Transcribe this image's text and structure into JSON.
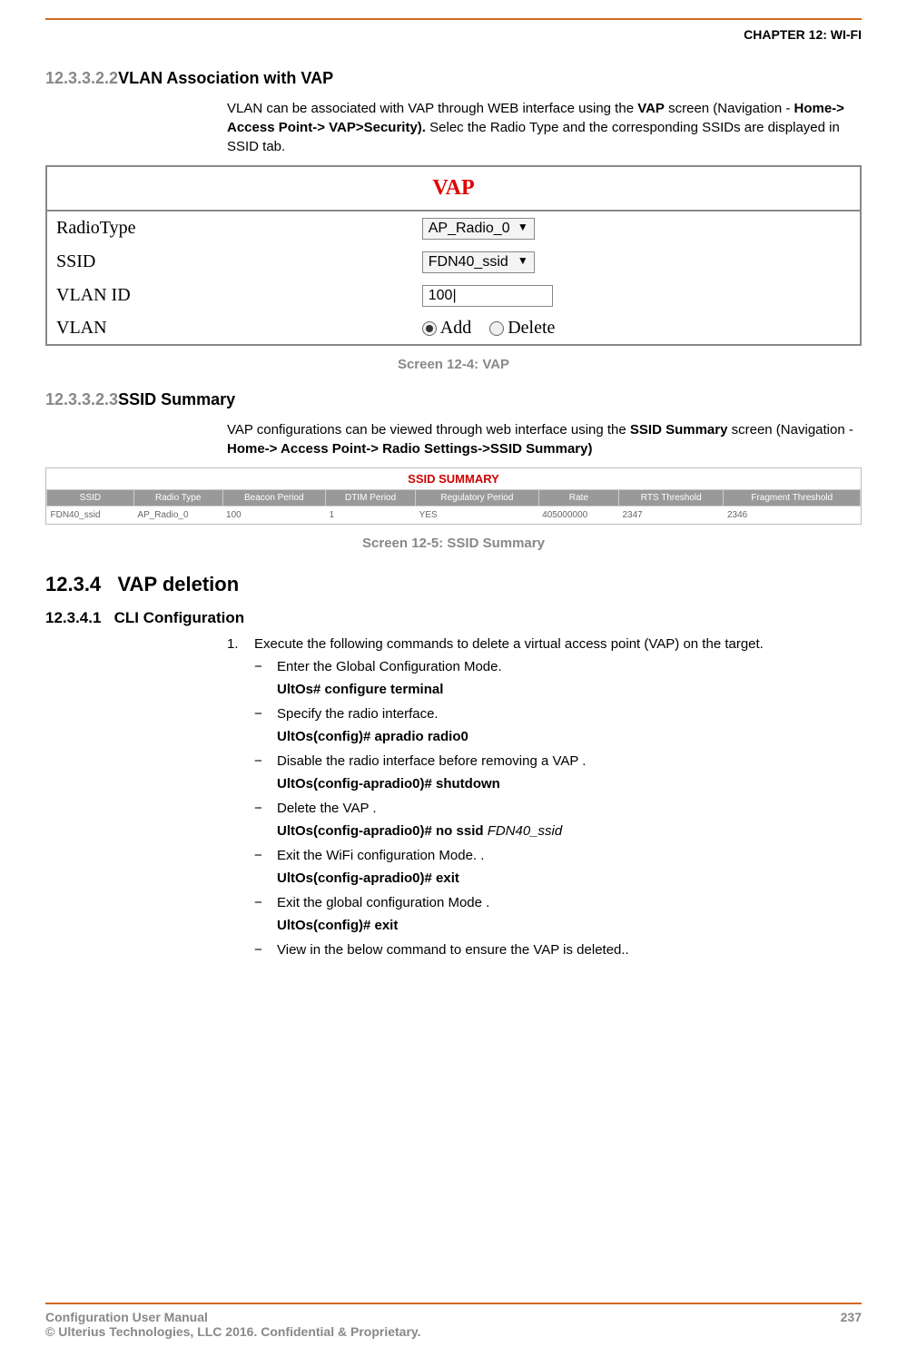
{
  "header": {
    "chapter": "CHAPTER 12: WI-FI"
  },
  "s1": {
    "num": "12.3.3.2.2",
    "title": "VLAN Association with VAP",
    "para_1": "VLAN can be associated with VAP through WEB interface using the ",
    "para_1b": "VAP",
    "para_2a": " screen (Navigation - ",
    "para_2b": "Home-> Access Point-> VAP>Security).",
    "para_2c": " Selec the Radio Type and the corresponding SSIDs are displayed in SSID tab.",
    "caption": "Screen 12-4: VAP"
  },
  "vap": {
    "title": "VAP",
    "rows": {
      "radiotype_label": "RadioType",
      "radiotype_value": "AP_Radio_0",
      "ssid_label": "SSID",
      "ssid_value": "FDN40_ssid",
      "vlanid_label": "VLAN ID",
      "vlanid_value": "100",
      "vlan_label": "VLAN",
      "add": "Add",
      "delete": "Delete"
    }
  },
  "s2": {
    "num": "12.3.3.2.3",
    "title": "SSID Summary",
    "para_a": "VAP configurations can be viewed through web interface using the ",
    "para_b": "SSID Summary",
    "para_c": " screen (Navigation - ",
    "para_d": "Home-> Access Point-> Radio Settings->SSID Summary)",
    "caption": "Screen 12-5: SSID Summary"
  },
  "ssid": {
    "title": "SSID SUMMARY",
    "headers": [
      "SSID",
      "Radio Type",
      "Beacon Period",
      "DTIM Period",
      "Regulatory Period",
      "Rate",
      "RTS Threshold",
      "Fragment Threshold"
    ],
    "row": [
      "FDN40_ssid",
      "AP_Radio_0",
      "100",
      "1",
      "YES",
      "405000000",
      "2347",
      "2346"
    ]
  },
  "s3": {
    "num": "12.3.4",
    "title": "VAP deletion"
  },
  "s4": {
    "num": "12.3.4.1",
    "title": "CLI Configuration",
    "step1": "Execute the following commands to delete a virtual access point (VAP) on the target.",
    "d1": "Enter the Global Configuration Mode.",
    "c1": "UltOs# configure terminal",
    "d2": "Specify the radio interface.",
    "c2": " UltOs(config)# apradio radio0",
    "d3": "Disable the radio interface before removing a VAP .",
    "c3": "UltOs(config-apradio0)# shutdown",
    "d4": "Delete the VAP .",
    "c4a": "UltOs(config-apradio0)# no ssid ",
    "c4b": "FDN40_ssid",
    "d5": "Exit the WiFi configuration Mode. .",
    "c5": "UltOs(config-apradio0)# exit",
    "d6": "Exit the global configuration Mode .",
    "c6": "UltOs(config)# exit",
    "d7": "View in the below command to ensure the VAP is deleted.."
  },
  "footer": {
    "left1": "Configuration User Manual",
    "left2": "© Ulterius Technologies, LLC 2016. Confidential & Proprietary.",
    "page": "237"
  }
}
